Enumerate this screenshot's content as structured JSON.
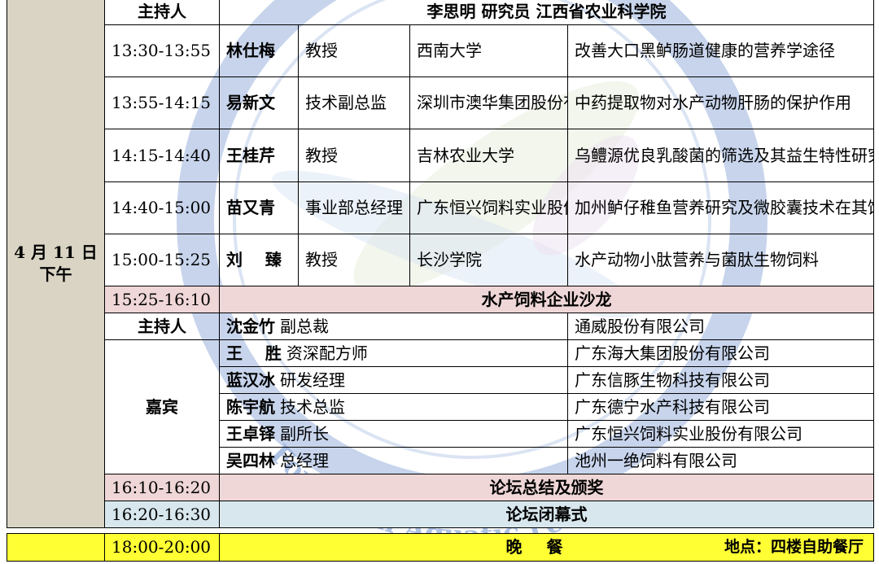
{
  "date": {
    "line1": "4 月 11 日",
    "line2": "下午"
  },
  "session_host": {
    "label": "主持人",
    "text": "李思明  研究员  江西省农业科学院"
  },
  "talks": [
    {
      "time": "13:30-13:55",
      "speaker": "林仕梅",
      "title": "教授",
      "org": "西南大学",
      "topic": "改善大口黑鲈肠道健康的营养学途径"
    },
    {
      "time": "13:55-14:15",
      "speaker": "易新文",
      "title": "技术副总监",
      "org": "深圳市澳华集团股份有限公司",
      "topic": "中药提取物对水产动物肝肠的保护作用"
    },
    {
      "time": "14:15-14:40",
      "speaker": "王桂芹",
      "title": "教授",
      "org": "吉林农业大学",
      "topic": "乌鳢源优良乳酸菌的筛选及其益生特性研究"
    },
    {
      "time": "14:40-15:00",
      "speaker": "苗又青",
      "title": "事业部总经理",
      "org": "广东恒兴饲料实业股份有限公司",
      "topic": "加州鲈仔稚鱼营养研究及微胶囊技术在其饲料中的应用"
    },
    {
      "time": "15:00-15:25",
      "speaker": "刘    臻",
      "title": "教授",
      "org": "长沙学院",
      "topic": "水产动物小肽营养与菌肽生物饲料"
    }
  ],
  "salon": {
    "time": "15:25-16:10",
    "title": "水产饲料企业沙龙"
  },
  "salon_host": {
    "label": "主持人",
    "name": "沈金竹",
    "role": "副总裁",
    "org": "通威股份有限公司"
  },
  "guests_label": "嘉宾",
  "guests": [
    {
      "name": "王    胜",
      "role": "资深配方师",
      "org": "广东海大集团股份有限公司"
    },
    {
      "name": "蓝汉冰",
      "role": "研发经理",
      "org": "广东信豚生物科技有限公司"
    },
    {
      "name": "陈宇航",
      "role": "技术总监",
      "org": "广东德宁水产科技有限公司"
    },
    {
      "name": "王卓铎",
      "role": "副所长",
      "org": "广东恒兴饲料实业股份有限公司"
    },
    {
      "name": "吴四林",
      "role": "总经理",
      "org": "池州一绝饲料有限公司"
    }
  ],
  "summary": {
    "time": "16:10-16:20",
    "title": "论坛总结及颁奖"
  },
  "closing": {
    "time": "16:20-16:30",
    "title": "论坛闭幕式"
  },
  "dinner": {
    "time": "18:00-20:00",
    "title": "晚餐",
    "location": "地点：四楼自助餐厅"
  },
  "watermark": {
    "text": "Forum on Aquatic Feed",
    "color": "#2f5fb3"
  },
  "colors": {
    "date_bg": "#d9d4c4",
    "pink": "#efd6d7",
    "blue": "#d8e7ee",
    "yellow": "#ffff33"
  }
}
